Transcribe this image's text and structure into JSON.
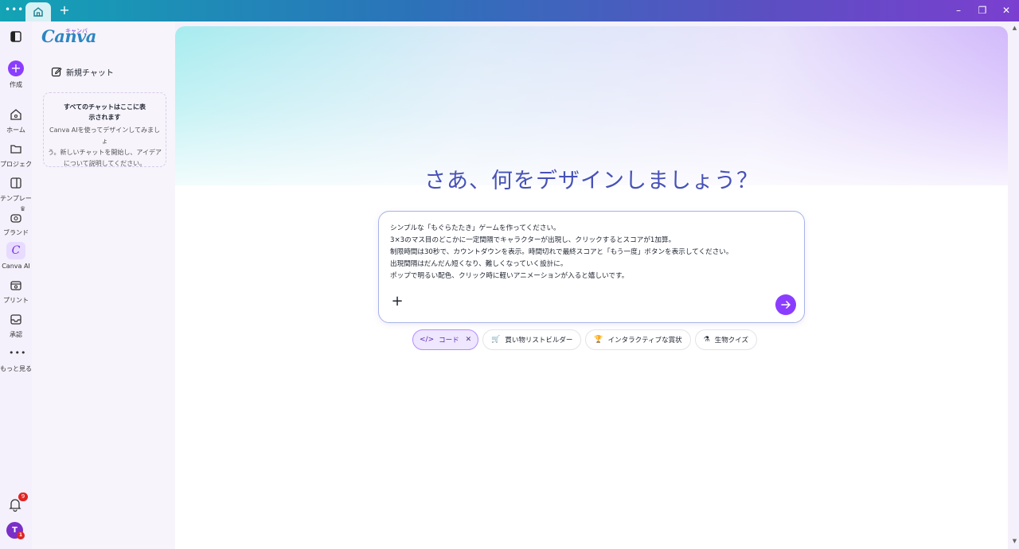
{
  "titlebar": {
    "more_icon": "more-dots-icon",
    "home_tab_icon": "home-icon",
    "new_tab_icon": "plus-icon",
    "window_controls": [
      "minimize-icon",
      "restore-icon",
      "close-icon"
    ]
  },
  "rail": {
    "toggle_icon": "sidebar-toggle-icon",
    "create_label": "作成",
    "items": [
      {
        "label": "ホーム",
        "icon": "home-icon"
      },
      {
        "label": "プロジェクト",
        "icon": "folder-icon"
      },
      {
        "label": "テンプレート",
        "icon": "template-icon"
      },
      {
        "label": "ブランド",
        "icon": "brand-icon"
      },
      {
        "label": "Canva AI",
        "icon": "canva-ai-icon"
      },
      {
        "label": "プリント",
        "icon": "print-icon"
      },
      {
        "label": "承認",
        "icon": "inbox-icon"
      },
      {
        "label": "もっと見る",
        "icon": "more-icon"
      }
    ],
    "notifications_count": "9",
    "avatar_initial": "T",
    "avatar_badge": "1"
  },
  "panel": {
    "logo": "Canva",
    "logo_kana": "キャンバ",
    "new_chat_label": "新規チャット",
    "empty_title_line1": "すべてのチャットはここに表",
    "empty_title_line2": "示されます",
    "empty_desc_line1": "Canva AIを使ってデザインしてみましょ",
    "empty_desc_line2": "う。新しいチャットを開始し、アイデア",
    "empty_desc_line3": "について説明してください。"
  },
  "main": {
    "headline": "さあ、何をデザインしましょう？",
    "prompt_text": "シンプルな「もぐらたたき」ゲームを作ってください。\n3×3のマス目のどこかに一定間隔でキャラクターが出現し、クリックするとスコアが1加算。\n制限時間は30秒で、カウントダウンを表示。時間切れで最終スコアと「もう一度」ボタンを表示してください。\n出現間隔はだんだん短くなり、難しくなっていく設計に。\nポップで明るい配色、クリック時に軽いアニメーションが入ると嬉しいです。",
    "chips": [
      {
        "label": "コード",
        "icon": "code-icon",
        "selected": true
      },
      {
        "label": "買い物リストビルダー",
        "icon": "cart-icon"
      },
      {
        "label": "インタラクティブな賞状",
        "icon": "trophy-icon"
      },
      {
        "label": "生物クイズ",
        "icon": "flask-icon"
      }
    ]
  },
  "colors": {
    "accent": "#8b3dff",
    "headline": "#4751b8"
  }
}
